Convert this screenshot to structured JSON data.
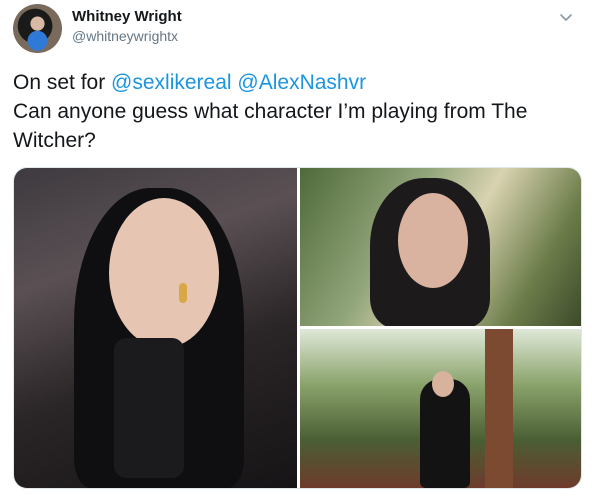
{
  "author": {
    "display_name": "Whitney Wright",
    "handle": "@whitneywrightx"
  },
  "tweet": {
    "prefix": "On set for ",
    "mention1": "@sexlikereal",
    "space": " ",
    "mention2": "@AlexNashvr",
    "body": "Can anyone guess what character I’m playing from The Witcher?"
  },
  "icons": {
    "menu": "chevron-down-icon"
  },
  "colors": {
    "link": "#1b95e0",
    "secondary_text": "#657786"
  }
}
